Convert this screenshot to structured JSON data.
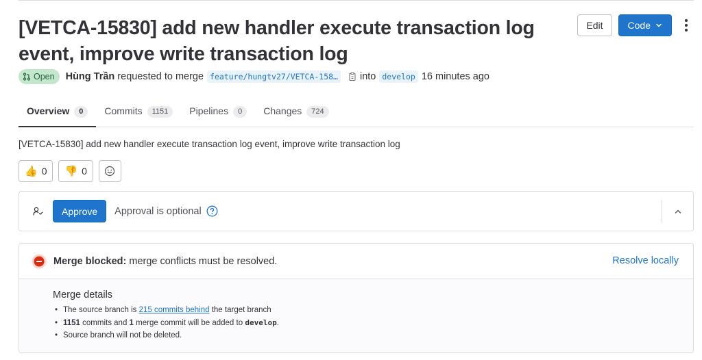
{
  "mr": {
    "title": "[VETCA-15830] add new handler execute transaction log event, improve write transaction log",
    "status": "Open",
    "author": "Hùng Trần",
    "requested_text": "requested to merge",
    "source_branch": "feature/hungtv27/VETCA-158…",
    "into_text": "into",
    "target_branch": "develop",
    "time_ago": "16 minutes ago"
  },
  "header": {
    "edit_label": "Edit",
    "code_label": "Code"
  },
  "tabs": [
    {
      "label": "Overview",
      "count": "0",
      "active": true
    },
    {
      "label": "Commits",
      "count": "1151"
    },
    {
      "label": "Pipelines",
      "count": "0"
    },
    {
      "label": "Changes",
      "count": "724"
    }
  ],
  "description": "[VETCA-15830] add new handler execute transaction log event, improve write transaction log",
  "awards": {
    "thumbsup": {
      "emoji": "👍",
      "count": "0"
    },
    "thumbsdown": {
      "emoji": "👎",
      "count": "0"
    }
  },
  "approval": {
    "button_label": "Approve",
    "text": "Approval is optional"
  },
  "merge": {
    "status_strong": "Merge blocked:",
    "status_text": "merge conflicts must be resolved.",
    "resolve_label": "Resolve locally",
    "details_title": "Merge details",
    "line1_pre": "The source branch is",
    "line1_link": "215 commits behind",
    "line1_post": "the target branch",
    "line2_count": "1151",
    "line2_mid": "commits and",
    "line2_merge_count": "1",
    "line2_post": "merge commit will be added to",
    "line2_branch": "develop",
    "line2_end": ".",
    "line3": "Source branch will not be deleted."
  },
  "colors": {
    "primary": "#1f75cb",
    "open_badge_bg": "#c3e6cd",
    "open_badge_fg": "#24663b",
    "blocked": "#dd2b0e"
  }
}
